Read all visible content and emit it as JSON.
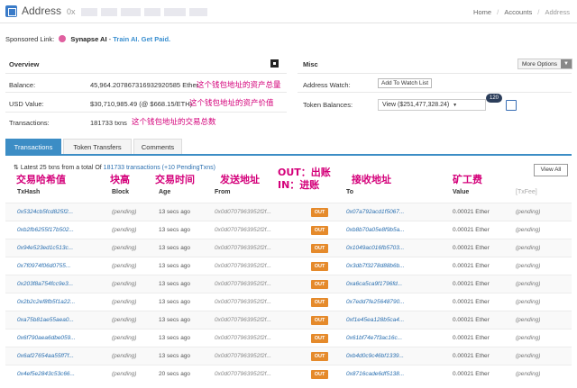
{
  "header": {
    "title": "Address",
    "address_prefix": "0x",
    "breadcrumbs": [
      "Home",
      "Accounts",
      "Address"
    ]
  },
  "sponsored": {
    "label": "Sponsored Link:",
    "brand": "Synapse AI",
    "tagline": "Train AI. Get Paid."
  },
  "overview": {
    "title": "Overview",
    "balance_label": "Balance:",
    "balance_value": "45,964.207867316932920585 Ether",
    "usd_label": "USD Value:",
    "usd_value": "$30,710,985.49 (@ $668.15/ETH)",
    "tx_label": "Transactions:",
    "tx_value": "181733 txns"
  },
  "misc": {
    "title": "Misc",
    "more_options": "More Options",
    "watch_label": "Address Watch:",
    "watch_button": "Add To Watch List",
    "token_label": "Token Balances:",
    "token_select": "View ($251,477,328.24)",
    "token_count": "120"
  },
  "annotations": {
    "balance": "这个钱包地址的资产总量",
    "usd": "这个钱包地址的资产价值",
    "tx": "这个钱包地址的交易总数",
    "col_hash": "交易哈希值",
    "col_block": "块高",
    "col_age": "交易时间",
    "col_from": "发送地址",
    "col_io_line1": "OUT：出账",
    "col_io_line2": "IN：进账",
    "col_to": "接收地址",
    "col_fee": "矿工费"
  },
  "tabs": [
    "Transactions",
    "Token Transfers",
    "Comments"
  ],
  "transactions": {
    "summary_prefix": "Latest 25 txns from a total Of",
    "summary_link": "181733 transactions",
    "summary_pending": "(+10 PendingTxns)",
    "view_all": "View All",
    "columns": [
      "TxHash",
      "Block",
      "Age",
      "From",
      "",
      "To",
      "Value",
      "[TxFee]"
    ],
    "rows": [
      {
        "hash": "0x5324cb5fcd825f2...",
        "block": "(pending)",
        "age": "13 secs ago",
        "from": "0x0d0707963952f2f...",
        "dir": "OUT",
        "to": "0x07a792acd1f5067...",
        "value": "0.00021 Ether",
        "fee": "(pending)"
      },
      {
        "hash": "0xb2fb6255f17b502...",
        "block": "(pending)",
        "age": "13 secs ago",
        "from": "0x0d0707963952f2f...",
        "dir": "OUT",
        "to": "0xb8b70a05e8f9b5a...",
        "value": "0.00021 Ether",
        "fee": "(pending)"
      },
      {
        "hash": "0x94e523ed1c513c...",
        "block": "(pending)",
        "age": "13 secs ago",
        "from": "0x0d0707963952f2f...",
        "dir": "OUT",
        "to": "0x1049ac016fb5703...",
        "value": "0.00021 Ether",
        "fee": "(pending)"
      },
      {
        "hash": "0x7f0974f06d0755...",
        "block": "(pending)",
        "age": "13 secs ago",
        "from": "0x0d0707963952f2f...",
        "dir": "OUT",
        "to": "0x3db7f3278d88b6b...",
        "value": "0.00021 Ether",
        "fee": "(pending)"
      },
      {
        "hash": "0x203f8a754fcc9e3...",
        "block": "(pending)",
        "age": "13 secs ago",
        "from": "0x0d0707963952f2f...",
        "dir": "OUT",
        "to": "0xa6ca5ca9f1796fd...",
        "value": "0.00021 Ether",
        "fee": "(pending)"
      },
      {
        "hash": "0x2b2c2ef8fb5f1a22...",
        "block": "(pending)",
        "age": "13 secs ago",
        "from": "0x0d0707963952f2f...",
        "dir": "OUT",
        "to": "0x7edd7fe25648790...",
        "value": "0.00021 Ether",
        "fee": "(pending)"
      },
      {
        "hash": "0xa75b81ae55aea0...",
        "block": "(pending)",
        "age": "13 secs ago",
        "from": "0x0d0707963952f2f...",
        "dir": "OUT",
        "to": "0xf1e45ea128b5ca4...",
        "value": "0.00021 Ether",
        "fee": "(pending)"
      },
      {
        "hash": "0x6f790aea6dbe059...",
        "block": "(pending)",
        "age": "13 secs ago",
        "from": "0x0d0707963952f2f...",
        "dir": "OUT",
        "to": "0x61bf74e7f3ac16c...",
        "value": "0.00021 Ether",
        "fee": "(pending)"
      },
      {
        "hash": "0x6af27654aa55ff7f...",
        "block": "(pending)",
        "age": "13 secs ago",
        "from": "0x0d0707963952f2f...",
        "dir": "OUT",
        "to": "0xb4d0c9c46bf1339...",
        "value": "0.00021 Ether",
        "fee": "(pending)"
      },
      {
        "hash": "0x4ef5e2843c53c66...",
        "block": "(pending)",
        "age": "20 secs ago",
        "from": "0x0d0707963952f2f...",
        "dir": "OUT",
        "to": "0x8716cade6df5138...",
        "value": "0.00021 Ether",
        "fee": "(pending)"
      }
    ]
  },
  "colors": {
    "accent": "#3c8dc5",
    "annotation": "#d4007a",
    "out_badge": "#e58a2b",
    "link": "#2a6fb0"
  }
}
